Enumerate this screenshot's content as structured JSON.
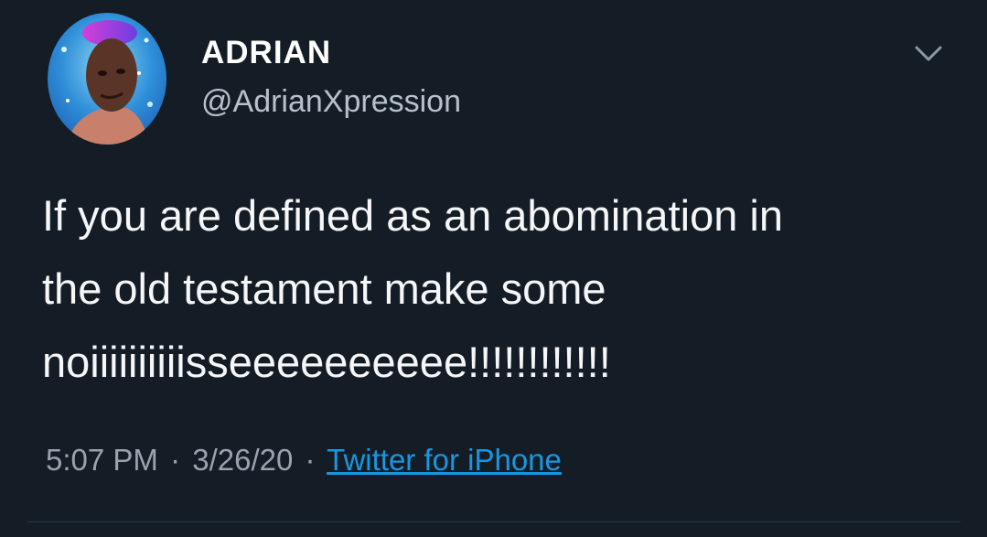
{
  "user": {
    "display_name": "ADRIAN",
    "handle": "@AdrianXpression"
  },
  "tweet": {
    "text": "If you are defined as an abomination in\nthe old testament make some\nnoiiiiiiiiiisseeeeeeeeee!!!!!!!!!!!!"
  },
  "meta": {
    "time": "5:07 PM",
    "date": "3/26/20",
    "separator": "·",
    "source": "Twitter for iPhone"
  },
  "icons": {
    "avatar": "profile-photo",
    "caret": "chevron-down-icon"
  },
  "colors": {
    "background": "#141d26",
    "link": "#1b95e0",
    "secondary_text": "#98a3ad"
  }
}
